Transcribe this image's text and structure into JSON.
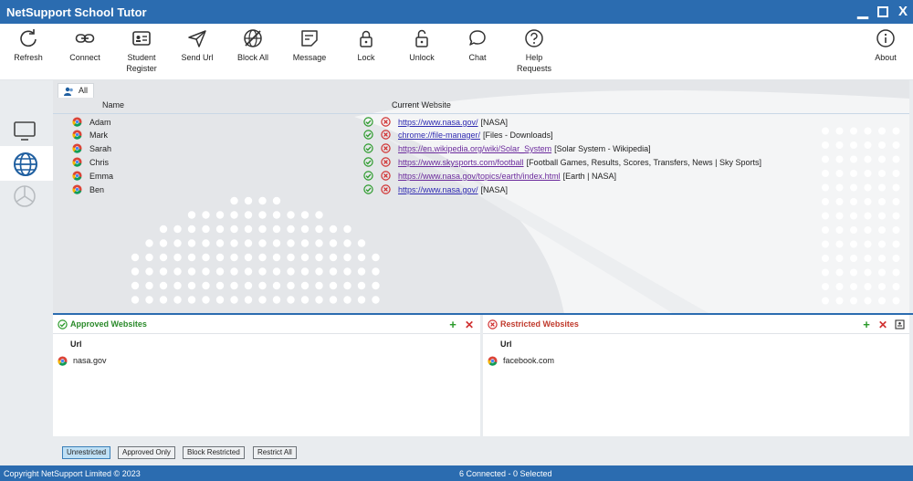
{
  "window": {
    "title": "NetSupport School Tutor"
  },
  "toolbar": {
    "refresh": "Refresh",
    "connect": "Connect",
    "student_register_1": "Student",
    "student_register_2": "Register",
    "send_url": "Send Url",
    "block_all": "Block All",
    "message": "Message",
    "lock": "Lock",
    "unlock": "Unlock",
    "chat": "Chat",
    "help_requests_1": "Help",
    "help_requests_2": "Requests",
    "about": "About"
  },
  "group_tab": {
    "label": "All"
  },
  "columns": {
    "name": "Name",
    "current_website": "Current Website"
  },
  "students": [
    {
      "name": "Adam",
      "url": "https://www.nasa.gov/",
      "page_title": "[NASA]"
    },
    {
      "name": "Mark",
      "url": "chrome://file-manager/",
      "page_title": "[Files - Downloads]"
    },
    {
      "name": "Sarah",
      "url": "https://en.wikipedia.org/wiki/Solar_System",
      "page_title": "[Solar System - Wikipedia]"
    },
    {
      "name": "Chris",
      "url": "https://www.skysports.com/football",
      "page_title": "[Football Games, Results, Scores, Transfers, News | Sky Sports]"
    },
    {
      "name": "Emma",
      "url": "https://www.nasa.gov/topics/earth/index.html",
      "page_title": "[Earth | NASA]"
    },
    {
      "name": "Ben",
      "url": "https://www.nasa.gov/",
      "page_title": "[NASA]"
    }
  ],
  "approved": {
    "title": "Approved Websites",
    "url_header": "Url",
    "items": [
      "nasa.gov"
    ]
  },
  "restricted": {
    "title": "Restricted Websites",
    "url_header": "Url",
    "items": [
      "facebook.com"
    ]
  },
  "modes": {
    "unrestricted": "Unrestricted",
    "approved_only": "Approved Only",
    "block_restricted": "Block Restricted",
    "restrict_all": "Restrict All",
    "active": "Unrestricted"
  },
  "status": {
    "copyright": "Copyright NetSupport Limited © 2023",
    "connections": "6 Connected - 0 Selected"
  },
  "colors": {
    "accent": "#2b6cb0",
    "approved": "#2a8a2a",
    "restricted": "#c0392b"
  }
}
